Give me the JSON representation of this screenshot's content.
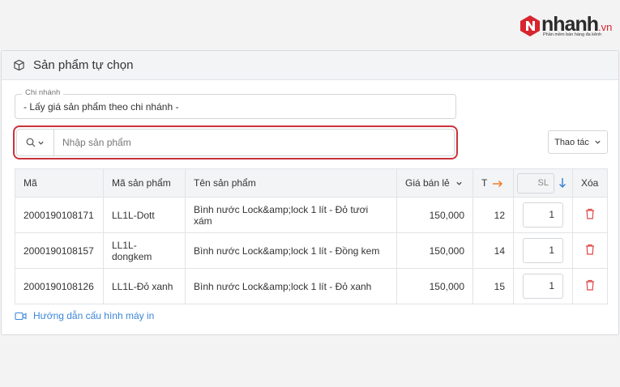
{
  "brand": {
    "name": "nhanh",
    "suffix": ".vn",
    "tagline": "Phần mềm bán hàng đa kênh",
    "color": "#d7262e"
  },
  "card": {
    "title": "Sản phẩm tự chọn",
    "icon": "box-icon"
  },
  "branch": {
    "label": "Chi nhánh",
    "value": "- Lấy giá sản phẩm theo chi nhánh -"
  },
  "search": {
    "placeholder": "Nhập sản phẩm",
    "value": "",
    "highlight_color": "#c9333b"
  },
  "actions": {
    "label": "Thao tác"
  },
  "table": {
    "headers": {
      "code": "Mã",
      "sku": "Mã sản phẩm",
      "name": "Tên sản phẩm",
      "price": "Giá bán lẻ",
      "stock": "T",
      "qty_placeholder": "SL",
      "delete": "Xóa"
    },
    "rows": [
      {
        "code": "2000190108171",
        "sku": "LL1L-Dott",
        "name": "Bình nước Lock&amp;lock 1 lít - Đỏ tươi xám",
        "price": "150,000",
        "stock": "12",
        "qty": "1"
      },
      {
        "code": "2000190108157",
        "sku": "LL1L-dongkem",
        "name": "Bình nước Lock&amp;lock 1 lít - Đồng kem",
        "price": "150,000",
        "stock": "14",
        "qty": "1"
      },
      {
        "code": "2000190108126",
        "sku": "LL1L-Đỏ xanh",
        "name": "Bình nước Lock&amp;lock 1 lít - Đỏ xanh",
        "price": "150,000",
        "stock": "15",
        "qty": "1"
      }
    ]
  },
  "guide": {
    "label": "Hướng dẫn cấu hình máy in",
    "color": "#3b86d8"
  },
  "colors": {
    "arrow_orange": "#f07c2d",
    "arrow_blue": "#3b86d8",
    "trash_red": "#e04848"
  }
}
